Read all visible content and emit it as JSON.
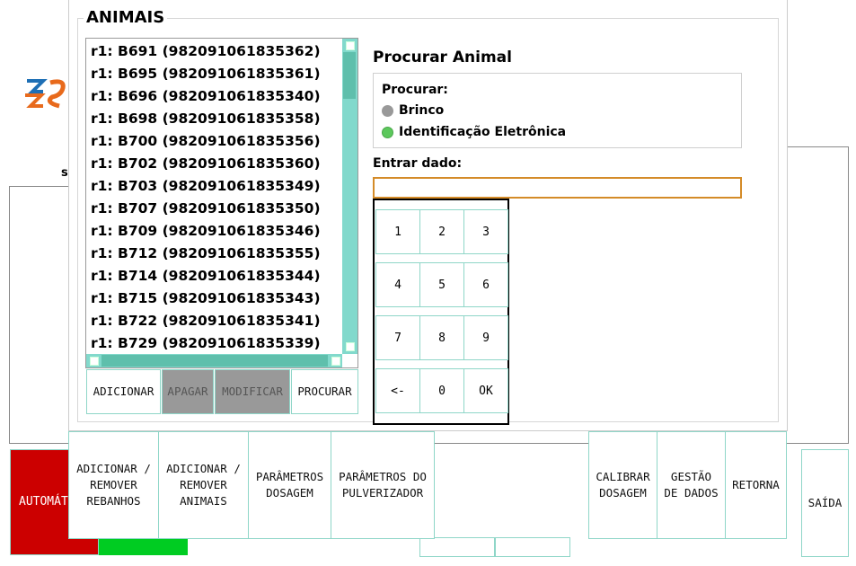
{
  "background": {
    "logo_icon": "logo-s-icon",
    "partial_label": "s",
    "automatic_label": "AUTOMÁTICO",
    "green_indicator_color": "#00cc22"
  },
  "dialog": {
    "title": "ANIMAIS",
    "animals": [
      "r1: B691 (982091061835362)",
      "r1: B695 (982091061835361)",
      "r1: B696 (982091061835340)",
      "r1: B698 (982091061835358)",
      "r1: B700 (982091061835356)",
      "r1: B702 (982091061835360)",
      "r1: B703 (982091061835349)",
      "r1: B707 (982091061835350)",
      "r1: B709 (982091061835346)",
      "r1: B712 (982091061835355)",
      "r1: B714 (982091061835344)",
      "r1: B715 (982091061835343)",
      "r1: B722 (982091061835341)",
      "r1: B729 (982091061835339)"
    ],
    "actions": {
      "add": "ADICIONAR",
      "delete": "APAGAR",
      "modify": "MODIFICAR",
      "search": "PROCURAR"
    },
    "search_panel": {
      "title": "Procurar Animal",
      "search_label": "Procurar:",
      "options": [
        "Brinco",
        "Identificação Eletrônica"
      ],
      "selected_option": "Identificação Eletrônica",
      "enter_label": "Entrar dado:",
      "input_value": ""
    },
    "keypad": [
      "1",
      "2",
      "3",
      "4",
      "5",
      "6",
      "7",
      "8",
      "9",
      "<-",
      "0",
      "OK"
    ]
  },
  "bottom_bar": {
    "buttons": [
      "ADICIONAR /\nREMOVER\nREBANHOS",
      "ADICIONAR /\nREMOVER\nANIMAIS",
      "PARÂMETROS\nDOSAGEM",
      "PARÂMETROS DO\nPULVERIZADOR",
      "CALIBRAR\nDOSAGEM",
      "GESTÃO\nDE DADOS",
      "RETORNA"
    ],
    "exit": "SAÍDA"
  },
  "colors": {
    "accent_teal": "#82d9cc",
    "button_border": "#8fd6c8",
    "entry_border": "#d48b28",
    "radio_off": "#999999",
    "radio_on": "#5cc85c",
    "red": "#cc0000"
  }
}
